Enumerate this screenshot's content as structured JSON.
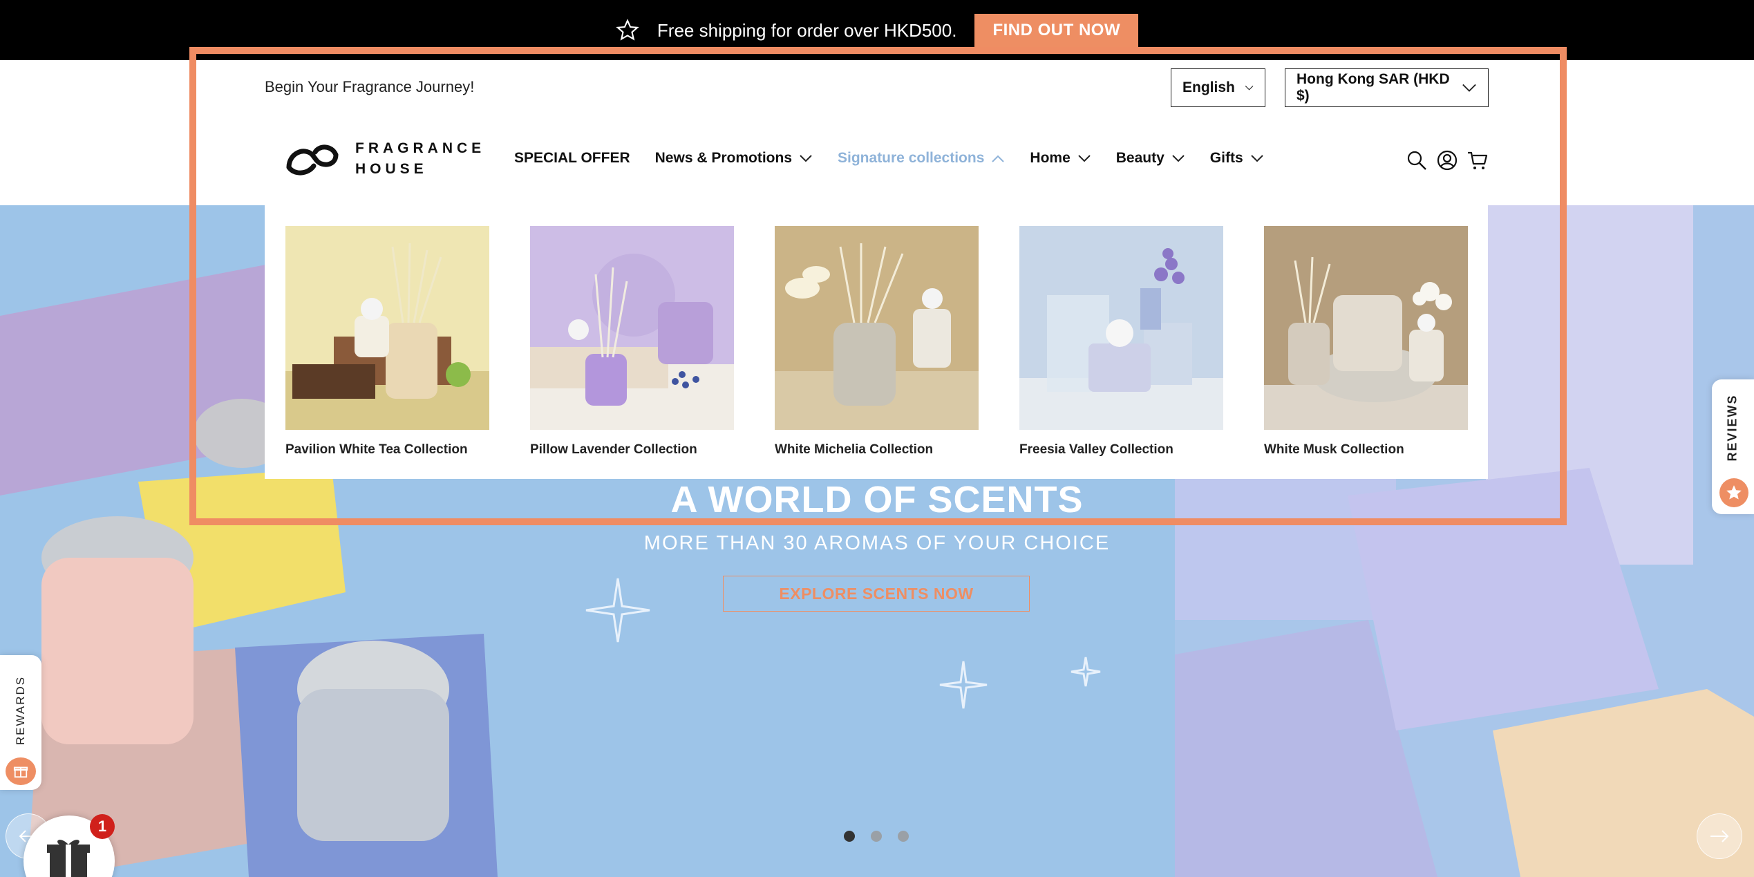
{
  "announcement": {
    "text": "Free shipping for order over HKD500.",
    "button_label": "FIND OUT NOW"
  },
  "header": {
    "tagline": "Begin Your Fragrance Journey!",
    "language": "English",
    "region": "Hong Kong SAR (HKD $)",
    "logo_line1": "FRAGRANCE",
    "logo_line2": "HOUSE"
  },
  "nav": {
    "items": [
      {
        "label": "SPECIAL OFFER"
      },
      {
        "label": "News & Promotions"
      },
      {
        "label": "Signature collections"
      },
      {
        "label": "Home"
      },
      {
        "label": "Beauty"
      },
      {
        "label": "Gifts"
      }
    ]
  },
  "mega_menu": {
    "collections": [
      {
        "label": "Pavilion White Tea Collection"
      },
      {
        "label": "Pillow Lavender Collection"
      },
      {
        "label": "White Michelia Collection"
      },
      {
        "label": "Freesia Valley Collection"
      },
      {
        "label": "White Musk Collection"
      }
    ]
  },
  "hero": {
    "title": "A WORLD OF SCENTS",
    "subtitle": "MORE THAN 30 AROMAS OF YOUR CHOICE",
    "cta": "EXPLORE SCENTS NOW",
    "active_slide": 1,
    "slide_count": 3
  },
  "widgets": {
    "reviews_label": "REVIEWS",
    "rewards_label": "REWARDS",
    "gift_badge_count": "1"
  },
  "colors": {
    "accent": "#ee8e63",
    "highlight": "#ef8c63",
    "active_nav": "#8fb3d9",
    "hero_bg": "#9dc4e8"
  }
}
